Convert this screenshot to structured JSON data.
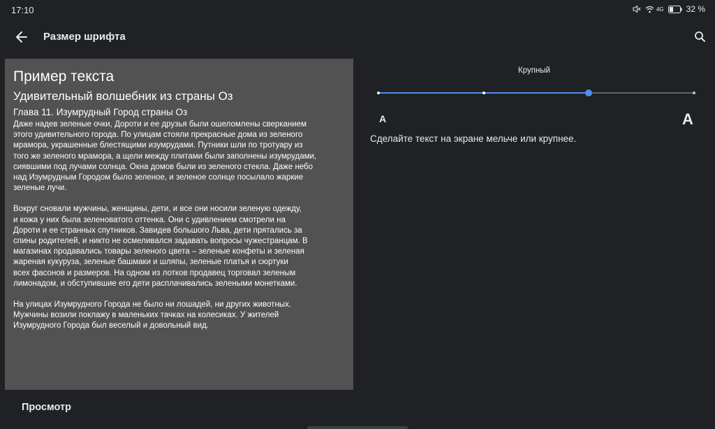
{
  "status": {
    "time": "17:10",
    "network": "4G",
    "battery_percent": "32 %",
    "icons": [
      "mute-icon",
      "wifi-icon",
      "battery-icon"
    ]
  },
  "appbar": {
    "title": "Размер шрифта",
    "back_icon": "arrow-back-icon",
    "search_icon": "search-icon"
  },
  "preview": {
    "heading": "Пример текста",
    "book_title": "Удивительный волшебник из страны Оз",
    "chapter": "Глава 11. Изумрудный Город страны Оз",
    "paragraphs": [
      "Даже надев зеленые очки, Дороти и ее друзья были ошеломлены сверканием\nэтого удивительного города. По улицам стояли прекрасные дома из зеленого\nмрамора, украшенные блестящими изумрудами. Путники шли по тротуару из\nтого же зеленого мрамора, а щели между плитами были заполнены изумрудами,\nсиявшими под лучами солнца. Окна домов были из зеленого стекла. Даже небо\nнад Изумрудным Городом было зеленое, и зеленое солнце посылало жаркие\nзеленые лучи.",
      "Вокруг сновали мужчины, женщины, дети, и все они носили зеленую одежду,\nи кожа у них была зеленоватого оттенка. Они с удивлением смотрели на\nДороти и ее странных спутников. Завидев большого Льва, дети прятались за\nспины родителей, и никто не осмеливался задавать вопросы чужестранцам. В\nмагазинах продавались товары зеленого цвета – зеленые конфеты и зеленая\nжареная кукуруза, зеленые башмаки и шляпы, зеленые платья и сюртуки\nвсех фасонов и размеров. На одном из лотков продавец торговал зеленым\nлимонадом, и обступившие его дети расплачивались зелеными монетками.",
      "На улицах Изумрудного Города не было ни лошадей, ни других животных.\nМужчины возили поклажу в маленьких тачках на колесиках. У жителей\nИзумрудного Города был веселый и довольный вид."
    ]
  },
  "font_size": {
    "current_label": "Крупный",
    "levels": 4,
    "selected_index": 2,
    "small_glyph": "A",
    "large_glyph": "A",
    "description": "Сделайте текст на экране мельче или крупнее."
  },
  "bottom": {
    "preview_label": "Просмотр"
  },
  "colors": {
    "background": "#202124",
    "preview_bg": "#525252",
    "accent": "#4f8ef7",
    "track_inactive": "#5f6368"
  }
}
